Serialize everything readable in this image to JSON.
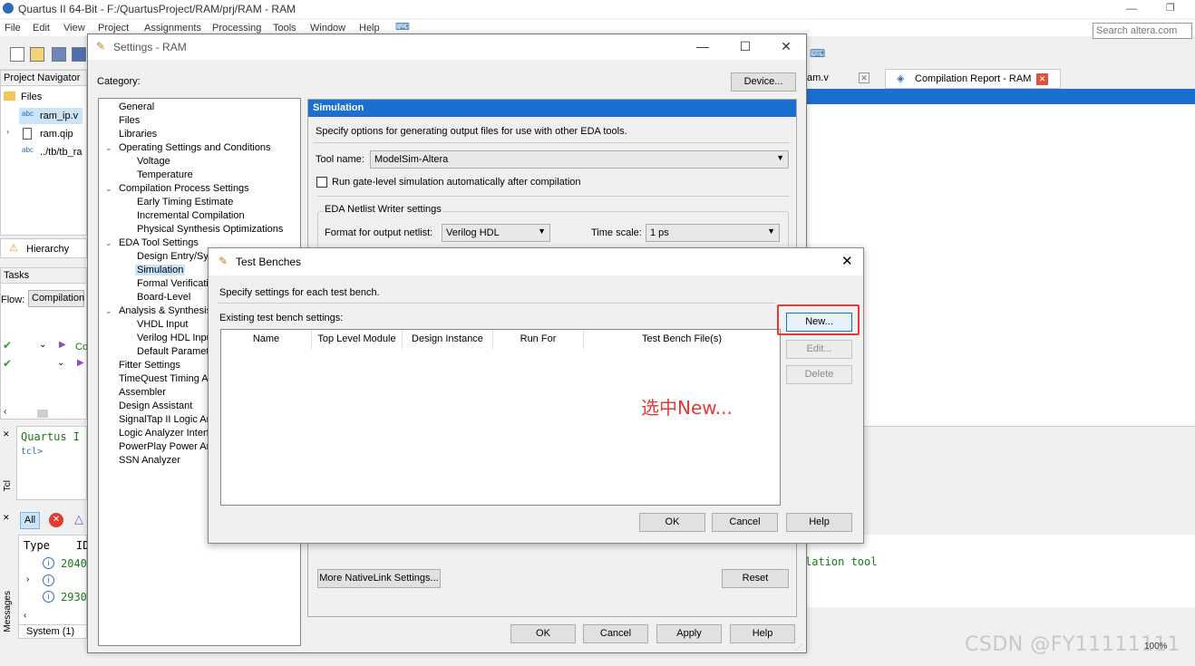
{
  "main_window": {
    "title": "Quartus II 64-Bit - F:/QuartusProject/RAM/prj/RAM - RAM",
    "menu": [
      "File",
      "Edit",
      "View",
      "Project",
      "Assignments",
      "Processing",
      "Tools",
      "Window",
      "Help"
    ],
    "search_placeholder": "Search altera.com",
    "tabs": {
      "ram_v": "am.v",
      "compilation_report": "Compilation Report - RAM"
    },
    "console_text": "lation tool"
  },
  "project_navigator": {
    "dropdown": "Project Navigator",
    "files_label": "Files",
    "files": [
      "ram_ip.v",
      "ram.qip",
      "../tb/tb_ra"
    ],
    "hierarchy_tab": "Hierarchy"
  },
  "tasks": {
    "header": "Tasks",
    "flow_label": "Flow:",
    "flow_value": "Compilation",
    "row1_text": "Co"
  },
  "tcl": {
    "label": "Tcl",
    "quartus_text": "Quartus I",
    "prompt": "tcl>"
  },
  "messages": {
    "label": "Messages",
    "filter_all": "All",
    "col_type": "Type",
    "col_id": "ID",
    "rows": [
      "2040",
      "",
      "2930"
    ],
    "tab_system": "System (1)"
  },
  "settings": {
    "title": "Settings - RAM",
    "category_label": "Category:",
    "device_button": "Device...",
    "tree": [
      {
        "label": "General",
        "level": 0
      },
      {
        "label": "Files",
        "level": 0
      },
      {
        "label": "Libraries",
        "level": 0
      },
      {
        "label": "Operating Settings and Conditions",
        "level": 0,
        "expanded": true
      },
      {
        "label": "Voltage",
        "level": 1
      },
      {
        "label": "Temperature",
        "level": 1
      },
      {
        "label": "Compilation Process Settings",
        "level": 0,
        "expanded": true
      },
      {
        "label": "Early Timing Estimate",
        "level": 1
      },
      {
        "label": "Incremental Compilation",
        "level": 1
      },
      {
        "label": "Physical Synthesis Optimizations",
        "level": 1
      },
      {
        "label": "EDA Tool Settings",
        "level": 0,
        "expanded": true
      },
      {
        "label": "Design Entry/Syr",
        "level": 1
      },
      {
        "label": "Simulation",
        "level": 1,
        "selected": true
      },
      {
        "label": "Formal Verificatio",
        "level": 1
      },
      {
        "label": "Board-Level",
        "level": 1
      },
      {
        "label": "Analysis & Synthesis",
        "level": 0,
        "expanded": true
      },
      {
        "label": "VHDL Input",
        "level": 1
      },
      {
        "label": "Verilog HDL Inpu",
        "level": 1
      },
      {
        "label": "Default Paramete",
        "level": 1
      },
      {
        "label": "Fitter Settings",
        "level": 0
      },
      {
        "label": "TimeQuest Timing An",
        "level": 0
      },
      {
        "label": "Assembler",
        "level": 0
      },
      {
        "label": "Design Assistant",
        "level": 0
      },
      {
        "label": "SignalTap II Logic An",
        "level": 0
      },
      {
        "label": "Logic Analyzer Interf",
        "level": 0
      },
      {
        "label": "PowerPlay Power An",
        "level": 0
      },
      {
        "label": "SSN Analyzer",
        "level": 0
      }
    ],
    "simulation": {
      "header": "Simulation",
      "description": "Specify options for generating output files for use with other EDA tools.",
      "tool_name_label": "Tool name:",
      "tool_name_value": "ModelSim-Altera",
      "run_gate_level_label": "Run gate-level simulation automatically after compilation",
      "netlist_group": "EDA Netlist Writer settings",
      "format_label": "Format for output netlist:",
      "format_value": "Verilog HDL",
      "time_scale_label": "Time scale:",
      "time_scale_value": "1 ps",
      "more_nativelink_button": "More NativeLink Settings...",
      "reset_button": "Reset"
    },
    "buttons": {
      "ok": "OK",
      "cancel": "Cancel",
      "apply": "Apply",
      "help": "Help"
    }
  },
  "test_benches": {
    "title": "Test Benches",
    "description": "Specify settings for each test bench.",
    "existing_label": "Existing test bench settings:",
    "columns": [
      "Name",
      "Top Level Module",
      "Design Instance",
      "Run For",
      "Test Bench File(s)"
    ],
    "buttons": {
      "new": "New...",
      "edit": "Edit...",
      "delete": "Delete",
      "ok": "OK",
      "cancel": "Cancel",
      "help": "Help"
    },
    "annotation": "选中New..."
  },
  "watermark": "CSDN @FY11111111",
  "zoom": "100%"
}
